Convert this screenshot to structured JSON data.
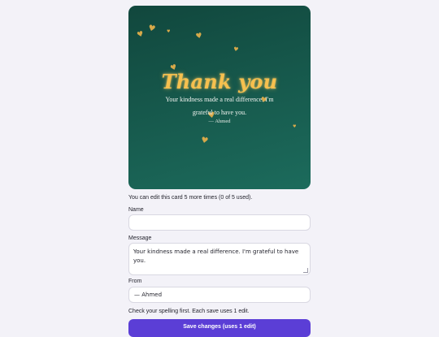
{
  "card": {
    "title": "Thank you",
    "message": "Your kindness made a real difference. I'm grateful to have you.",
    "from": "— Ahmed",
    "accent_color": "#f6c04e",
    "heart_icon": "♥"
  },
  "form": {
    "edit_notice": "You can edit this card 5 more times (0 of 5 used).",
    "name_label": "Name",
    "name_value": "",
    "message_label": "Message",
    "message_value": "Your kindness made a real difference. I'm grateful to have you.",
    "from_label": "From",
    "from_value": "— Ahmed",
    "hint": "Check your spelling first. Each save uses 1 edit.",
    "save_label": "Save changes (uses 1 edit)"
  },
  "colors": {
    "page_bg": "#f3f2f8",
    "card_bg": "#175b4e",
    "button_bg": "#5b3ed6"
  }
}
